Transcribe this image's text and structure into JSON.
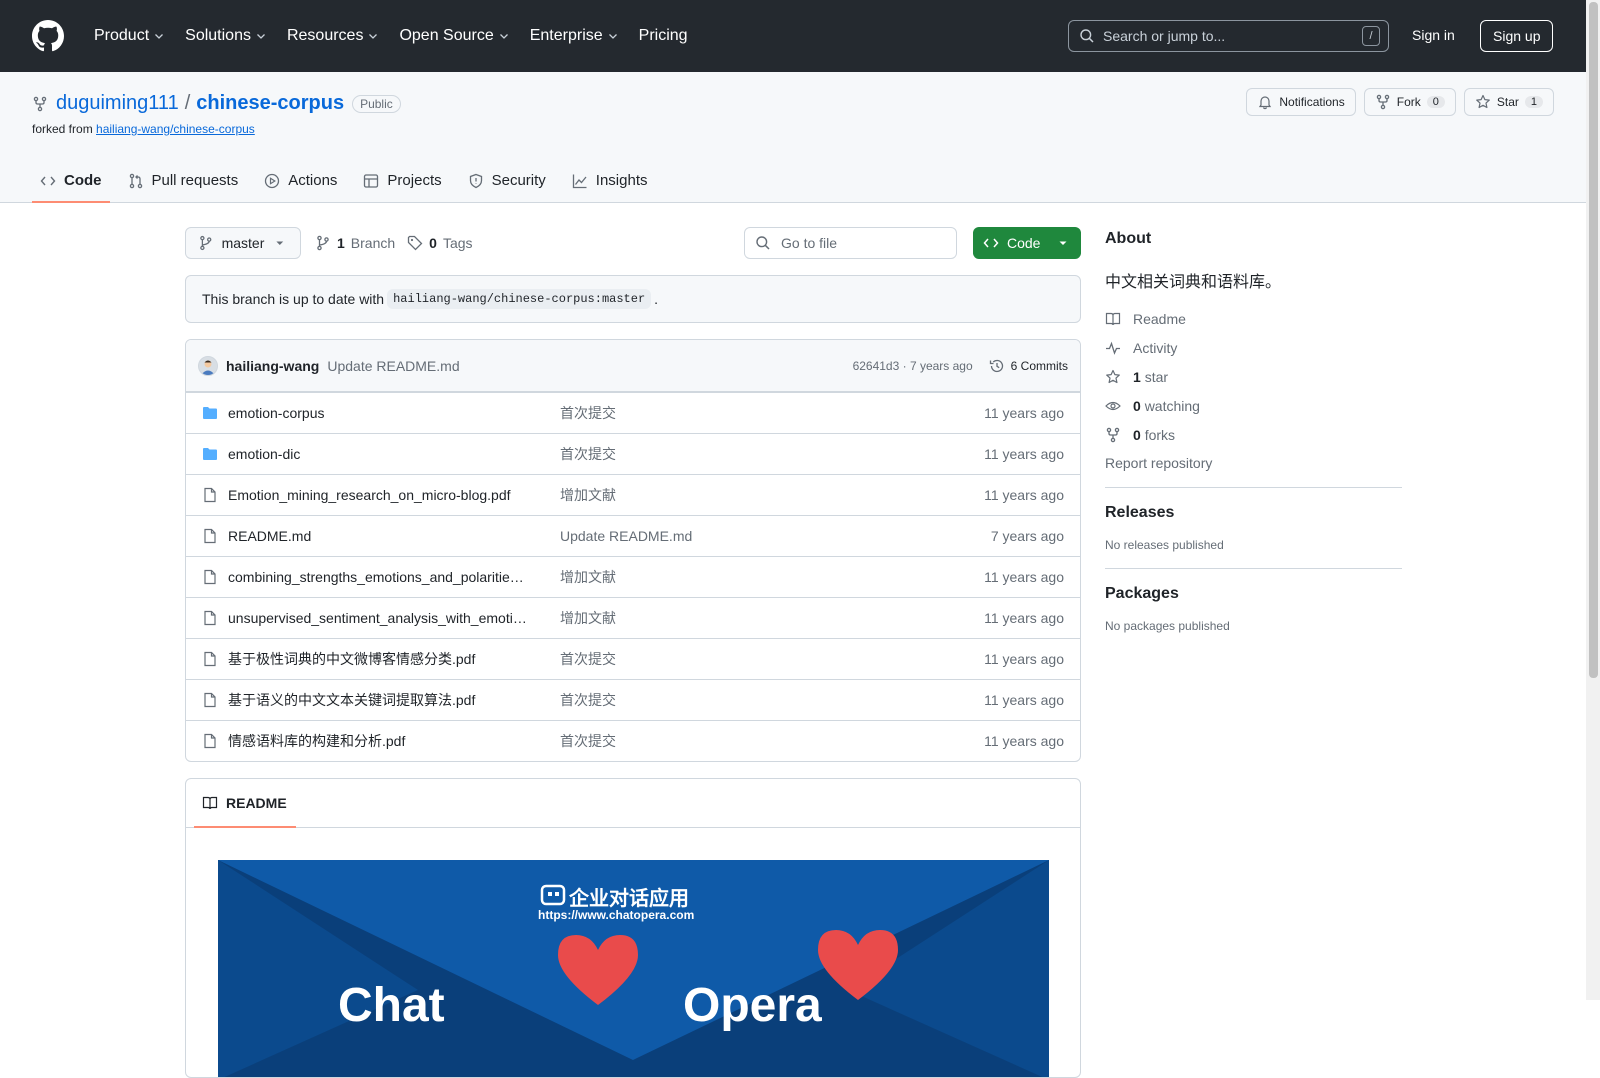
{
  "header": {
    "nav": [
      {
        "label": "Product",
        "caret": true
      },
      {
        "label": "Solutions",
        "caret": true
      },
      {
        "label": "Resources",
        "caret": true
      },
      {
        "label": "Open Source",
        "caret": true
      },
      {
        "label": "Enterprise",
        "caret": true
      },
      {
        "label": "Pricing",
        "caret": false
      }
    ],
    "search_placeholder": "Search or jump to...",
    "search_shortcut": "/",
    "signin": "Sign in",
    "signup": "Sign up"
  },
  "repo": {
    "owner": "duguiming111",
    "separator": "/",
    "name": "chinese-corpus",
    "visibility": "Public",
    "forked_prefix": "forked from",
    "forked_from": "hailiang-wang/chinese-corpus",
    "actions": {
      "notifications": "Notifications",
      "fork": "Fork",
      "fork_count": "0",
      "star": "Star",
      "star_count": "1"
    },
    "tabs": [
      "Code",
      "Pull requests",
      "Actions",
      "Projects",
      "Security",
      "Insights"
    ]
  },
  "toolbar": {
    "branch": "master",
    "branch_count": "1",
    "branch_label": "Branch",
    "tag_count": "0",
    "tag_label": "Tags",
    "goto_placeholder": "Go to file",
    "code_button": "Code"
  },
  "uptodate": {
    "prefix": "This branch is up to date with",
    "ref": "hailiang-wang/chinese-corpus:master",
    "suffix": "."
  },
  "commit": {
    "author": "hailiang-wang",
    "message": "Update README.md",
    "sha_time": "62641d3 · 7 years ago",
    "commits_label": "6 Commits"
  },
  "files": [
    {
      "name": "emotion-corpus",
      "type": "dir",
      "message": "首次提交",
      "date": "11 years ago"
    },
    {
      "name": "emotion-dic",
      "type": "dir",
      "message": "首次提交",
      "date": "11 years ago"
    },
    {
      "name": "Emotion_mining_research_on_micro-blog.pdf",
      "type": "file",
      "message": "增加文献",
      "date": "11 years ago"
    },
    {
      "name": "README.md",
      "type": "file",
      "message": "Update README.md",
      "date": "7 years ago"
    },
    {
      "name": "combining_strengths_emotions_and_polaritie…",
      "type": "file",
      "message": "增加文献",
      "date": "11 years ago"
    },
    {
      "name": "unsupervised_sentiment_analysis_with_emoti…",
      "type": "file",
      "message": "增加文献",
      "date": "11 years ago"
    },
    {
      "name": "基于极性词典的中文微博客情感分类.pdf",
      "type": "file",
      "message": "首次提交",
      "date": "11 years ago"
    },
    {
      "name": "基于语义的中文文本关键词提取算法.pdf",
      "type": "file",
      "message": "首次提交",
      "date": "11 years ago"
    },
    {
      "name": "情感语料库的构建和分析.pdf",
      "type": "file",
      "message": "首次提交",
      "date": "11 years ago"
    }
  ],
  "readme": {
    "tab": "README",
    "banner_title": "企业对话应用",
    "banner_url": "https://www.chatopera.com",
    "banner_partial_left": "Chat",
    "banner_partial_right": "Opera"
  },
  "sidebar": {
    "about_title": "About",
    "description": "中文相关词典和语料库。",
    "items": [
      {
        "icon": "book-icon",
        "count": "",
        "label": "Readme"
      },
      {
        "icon": "pulse-icon",
        "count": "",
        "label": "Activity"
      },
      {
        "icon": "star-icon",
        "count": "1",
        "label": "star"
      },
      {
        "icon": "eye-icon",
        "count": "0",
        "label": "watching"
      },
      {
        "icon": "fork-icon",
        "count": "0",
        "label": "forks"
      }
    ],
    "report": "Report repository",
    "releases_title": "Releases",
    "releases_text": "No releases published",
    "packages_title": "Packages",
    "packages_text": "No packages published"
  },
  "colors": {
    "header_bg": "#24292f",
    "link": "#0969da",
    "code_button": "#1f883d",
    "tab_underline": "#fd8c73",
    "folder": "#54aeff",
    "banner": "#0f5aa8",
    "heart": "#e94b4b"
  }
}
